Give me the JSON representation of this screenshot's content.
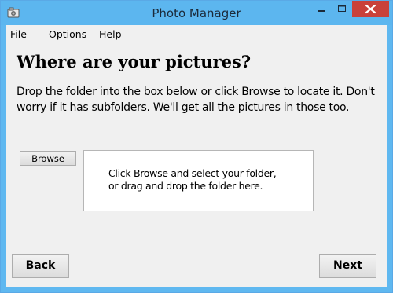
{
  "window": {
    "title": "Photo Manager",
    "icons": {
      "app": "camera-folder-icon",
      "minimize": "minimize-icon",
      "maximize": "maximize-icon",
      "close": "close-icon"
    }
  },
  "menu": {
    "items": [
      {
        "label": "File"
      },
      {
        "label": "Options"
      },
      {
        "label": "Help"
      }
    ]
  },
  "main": {
    "heading": "Where are your pictures?",
    "description": "Drop the folder into the box below or click Browse to locate it.  Don't worry if it has subfolders.  We'll get all the pictures in those too.",
    "browse_label": "Browse",
    "drop_line1": "Click Browse and select your folder,",
    "drop_line2": "or drag and drop the folder here."
  },
  "footer": {
    "back_label": "Back",
    "next_label": "Next"
  },
  "colors": {
    "titlebar": "#5cb6ef",
    "close_button": "#c9413a",
    "client_bg": "#f0f0f0"
  }
}
